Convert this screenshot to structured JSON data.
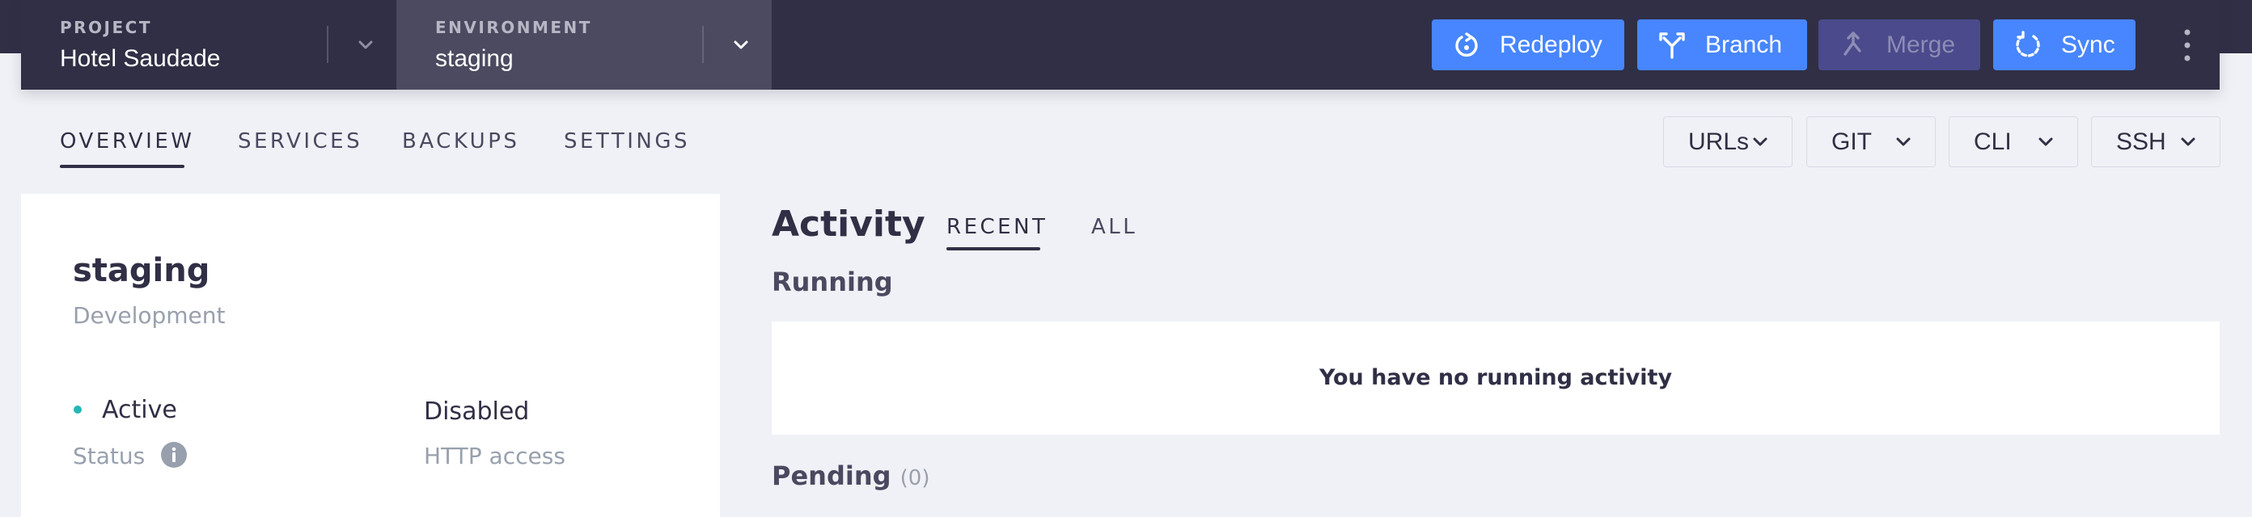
{
  "header": {
    "project": {
      "label": "PROJECT",
      "value": "Hotel Saudade"
    },
    "environment": {
      "label": "ENVIRONMENT",
      "value": "staging"
    },
    "actions": {
      "redeploy": "Redeploy",
      "branch": "Branch",
      "merge": "Merge",
      "sync": "Sync"
    }
  },
  "nav": {
    "tabs": [
      "OVERVIEW",
      "SERVICES",
      "BACKUPS",
      "SETTINGS"
    ],
    "active_tab": "OVERVIEW",
    "dropdowns": [
      "URLs",
      "GIT",
      "CLI",
      "SSH"
    ]
  },
  "environment_card": {
    "name": "staging",
    "type": "Development",
    "status_value": "Active",
    "status_label": "Status",
    "http_access_value": "Disabled",
    "http_access_label": "HTTP access"
  },
  "activity": {
    "title": "Activity",
    "tabs": [
      "RECENT",
      "ALL"
    ],
    "active_tab": "RECENT",
    "running_heading": "Running",
    "running_empty_message": "You have no running activity",
    "pending_heading": "Pending",
    "pending_count": "(0)"
  },
  "colors": {
    "header_bg": "#302f45",
    "env_selector_bg": "#4b4a60",
    "primary_button": "#4786ff",
    "disabled_button": "#4b4a8c",
    "status_active": "#23b7b7",
    "page_bg": "#f0f1f6"
  },
  "icons": {
    "redeploy": "redeploy-icon",
    "branch": "branch-icon",
    "merge": "merge-icon",
    "sync": "sync-icon",
    "more": "kebab-menu-icon",
    "info": "info-icon",
    "caret": "chevron-down-icon"
  }
}
